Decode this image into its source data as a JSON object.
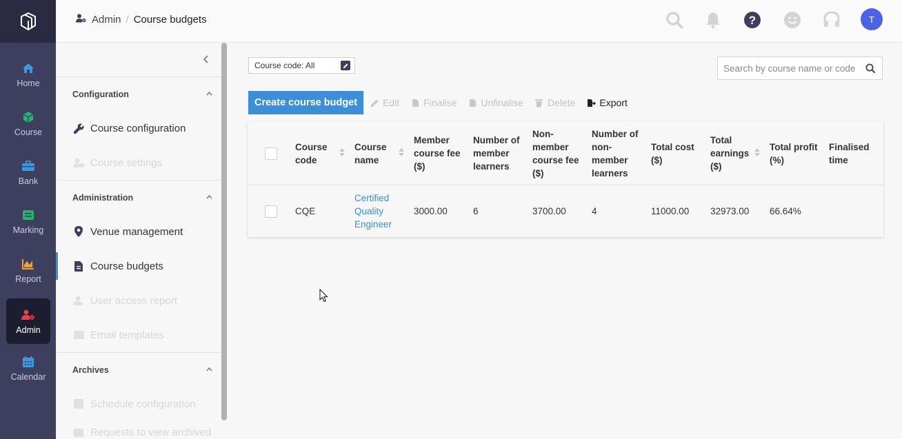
{
  "rail": {
    "items": [
      {
        "label": "Home",
        "icon": "home-icon",
        "color": "#3a9ae0"
      },
      {
        "label": "Course",
        "icon": "cube-icon",
        "color": "#27b36b"
      },
      {
        "label": "Bank",
        "icon": "briefcase-icon",
        "color": "#3a9ae0"
      },
      {
        "label": "Marking",
        "icon": "marking-icon",
        "color": "#27b36b"
      },
      {
        "label": "Report",
        "icon": "chart-icon",
        "color": "#f0a52a"
      },
      {
        "label": "Admin",
        "icon": "admin-icon",
        "color": "#e8404a"
      },
      {
        "label": "Calendar",
        "icon": "calendar-icon",
        "color": "#3a9ae0"
      }
    ]
  },
  "breadcrumb": {
    "section": "Admin",
    "page": "Course budgets"
  },
  "header": {
    "avatar_initial": "T"
  },
  "sidebar": {
    "sections": [
      {
        "title": "Configuration",
        "items": [
          {
            "label": "Course configuration",
            "icon": "wrench-icon",
            "enabled": true
          },
          {
            "label": "Course settings",
            "icon": "settings-icon",
            "enabled": false
          }
        ]
      },
      {
        "title": "Administration",
        "items": [
          {
            "label": "Venue management",
            "icon": "location-pin-icon",
            "enabled": true
          },
          {
            "label": "Course budgets",
            "icon": "document-icon",
            "enabled": true,
            "active": true
          },
          {
            "label": "User access report",
            "icon": "user-icon",
            "enabled": false
          },
          {
            "label": "Email templates",
            "icon": "envelope-icon",
            "enabled": false
          }
        ]
      },
      {
        "title": "Archives",
        "items": [
          {
            "label": "Schedule configuration",
            "icon": "calendar-icon",
            "enabled": false
          },
          {
            "label": "Requests to view archived",
            "icon": "folder-icon",
            "enabled": false
          }
        ]
      }
    ]
  },
  "filter": {
    "label": "Course code: All"
  },
  "search": {
    "placeholder": "Search by course name or code"
  },
  "toolbar": {
    "create_label": "Create course budget",
    "edit_label": "Edit",
    "finalise_label": "Finalise",
    "unfinalise_label": "Unfinalise",
    "delete_label": "Delete",
    "export_label": "Export"
  },
  "table": {
    "columns": [
      "Course code",
      "Course name",
      "Member course fee ($)",
      "Number of member learners",
      "Non-member course fee ($)",
      "Number of non-member learners",
      "Total cost ($)",
      "Total earnings ($)",
      "Total profit (%)",
      "Finalised time"
    ],
    "rows": [
      {
        "course_code": "CQE",
        "course_name": "Certified Quality Engineer",
        "member_fee": "3000.00",
        "member_learners": "6",
        "nonmember_fee": "3700.00",
        "nonmember_learners": "4",
        "total_cost": "11000.00",
        "total_earnings": "32973.00",
        "total_profit": "66.64%",
        "finalised_time": ""
      }
    ]
  },
  "colors": {
    "accent": "#3a8fd6",
    "rail_bg": "#3e3f5e",
    "avatar": "#4a63e7"
  }
}
